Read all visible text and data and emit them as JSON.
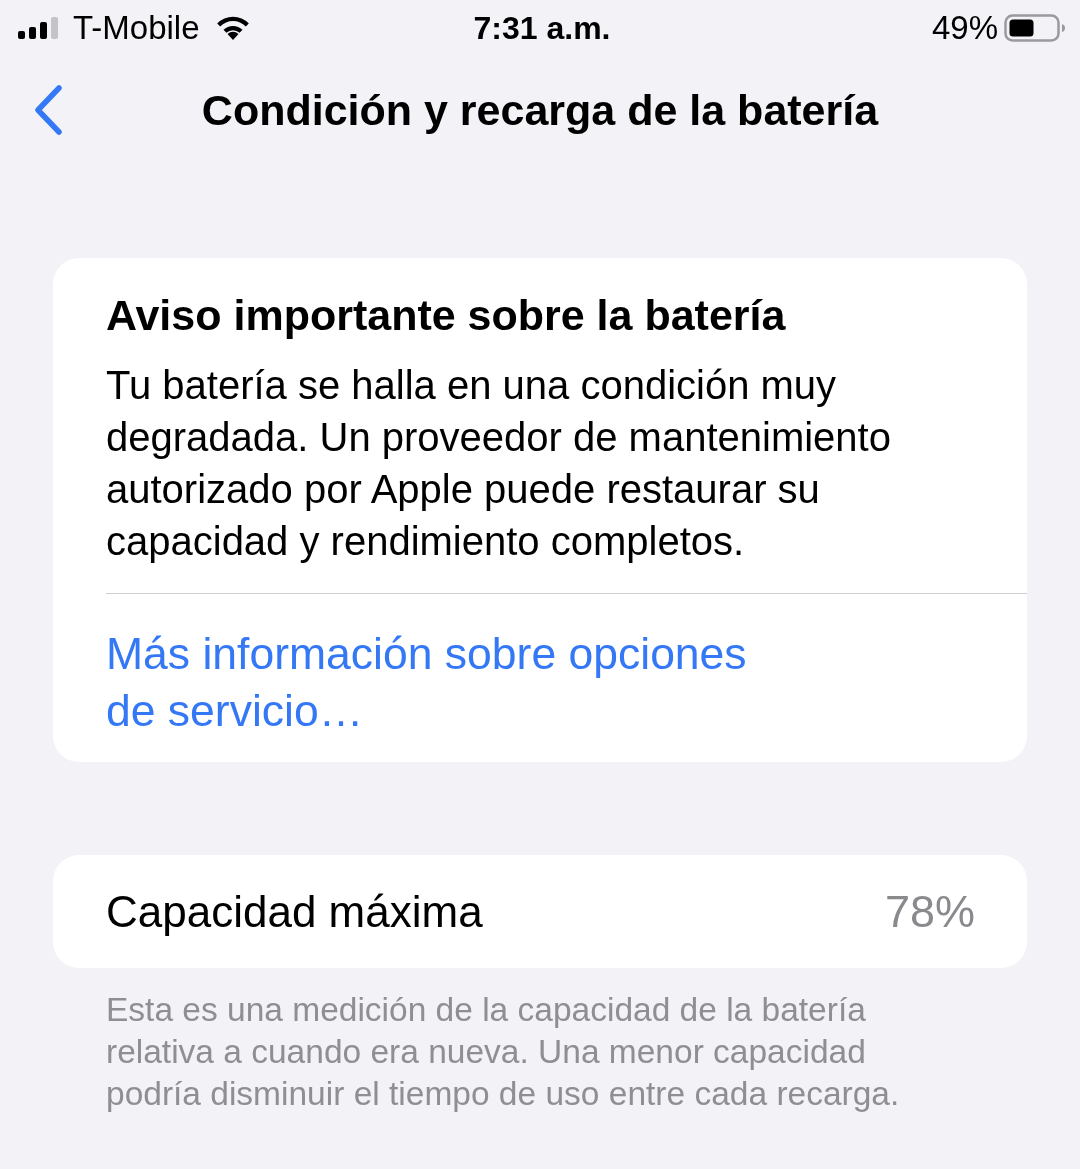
{
  "status_bar": {
    "carrier": "T-Mobile",
    "time": "7:31 a.m.",
    "battery_percent": "49%"
  },
  "nav": {
    "title": "Condición y recarga de la batería"
  },
  "notice": {
    "title": "Aviso importante sobre la batería",
    "body": "Tu batería se halla en una condición muy degradada. Un proveedor de mantenimiento autorizado por Apple puede restaurar su capacidad y rendimiento completos.",
    "link": "Más información sobre opciones de servicio…"
  },
  "capacity": {
    "label": "Capacidad máxima",
    "value": "78%",
    "footnote": "Esta es una medición de la capacidad de la batería relativa a cuando era nueva. Una menor capacidad podría disminuir el tiempo de uso entre cada recarga."
  }
}
